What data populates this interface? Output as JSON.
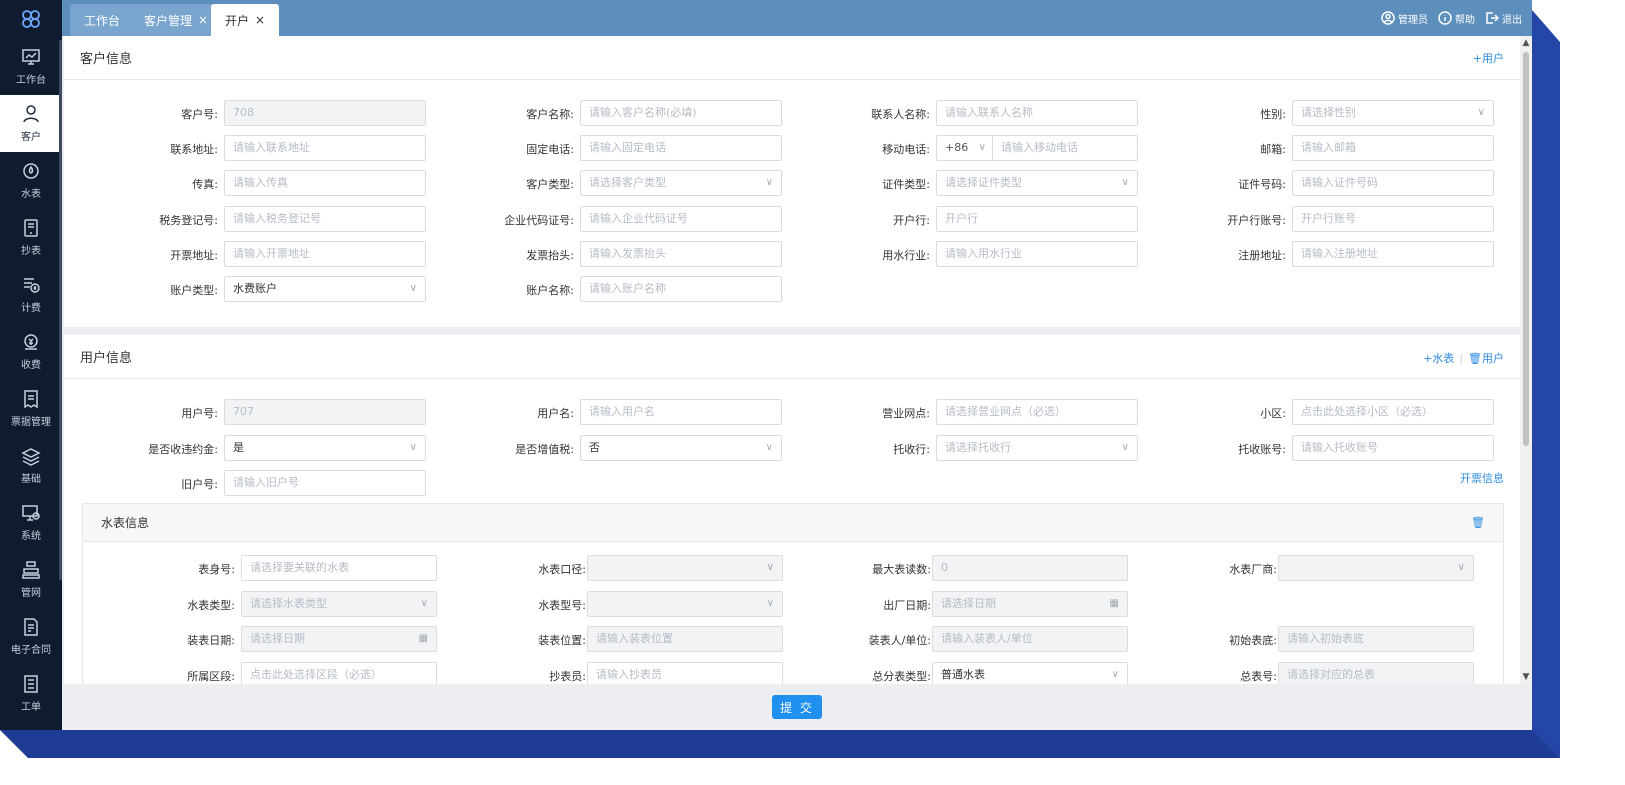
{
  "tabs": [
    {
      "label": "工作台",
      "closable": false
    },
    {
      "label": "客户管理",
      "closable": true
    },
    {
      "label": "开户",
      "closable": true,
      "active": true
    }
  ],
  "header": {
    "admin": "管理员",
    "help": "帮助",
    "logout": "退出"
  },
  "sidebar": [
    {
      "label": "工作台",
      "icon": "monitor-chart-icon"
    },
    {
      "label": "客户",
      "icon": "user-icon",
      "active": true
    },
    {
      "label": "水表",
      "icon": "water-meter-icon"
    },
    {
      "label": "抄表",
      "icon": "tablet-icon"
    },
    {
      "label": "计费",
      "icon": "billing-icon"
    },
    {
      "label": "收费",
      "icon": "coin-icon"
    },
    {
      "label": "票据管理",
      "icon": "receipt-icon"
    },
    {
      "label": "基础",
      "icon": "layers-icon"
    },
    {
      "label": "系统",
      "icon": "system-settings-icon"
    },
    {
      "label": "管网",
      "icon": "pipe-network-icon"
    },
    {
      "label": "电子合同",
      "icon": "contract-icon"
    },
    {
      "label": "工单",
      "icon": "work-order-icon"
    }
  ],
  "customer": {
    "title": "客户信息",
    "add_user": "+用户",
    "rows": [
      [
        {
          "label": "客户号:",
          "text": "708",
          "style": "dis"
        },
        {
          "label": "客户名称:",
          "text": "请输入客户名称(必填)"
        },
        {
          "label": "联系人名称:",
          "text": "请输入联系人名称"
        },
        {
          "label": "性别:",
          "text": "请选择性别",
          "select": true
        }
      ],
      [
        {
          "label": "联系地址:",
          "text": "请输入联系地址"
        },
        {
          "label": "固定电话:",
          "text": "请输入固定电话"
        },
        {
          "label": "移动电话:",
          "text": "请输入移动电话",
          "prefix": "+86"
        },
        {
          "label": "邮箱:",
          "text": "请输入邮箱"
        }
      ],
      [
        {
          "label": "传真:",
          "text": "请输入传真"
        },
        {
          "label": "客户类型:",
          "text": "请选择客户类型",
          "select": true
        },
        {
          "label": "证件类型:",
          "text": "请选择证件类型",
          "select": true
        },
        {
          "label": "证件号码:",
          "text": "请输入证件号码"
        }
      ],
      [
        {
          "label": "税务登记号:",
          "text": "请输入税务登记号"
        },
        {
          "label": "企业代码证号:",
          "text": "请输入企业代码证号"
        },
        {
          "label": "开户行:",
          "text": "开户行"
        },
        {
          "label": "开户行账号:",
          "text": "开户行账号"
        }
      ],
      [
        {
          "label": "开票地址:",
          "text": "请输入开票地址"
        },
        {
          "label": "发票抬头:",
          "text": "请输入发票抬头"
        },
        {
          "label": "用水行业:",
          "text": "请输入用水行业"
        },
        {
          "label": "注册地址:",
          "text": "请输入注册地址"
        }
      ],
      [
        {
          "label": "账户类型:",
          "text": "水费账户",
          "select": true,
          "style": "val"
        },
        {
          "label": "账户名称:",
          "text": "请输入账户名称"
        }
      ]
    ]
  },
  "user": {
    "title": "用户信息",
    "add_meter": "+水表",
    "delete_user": "用户",
    "invoice_link": "开票信息",
    "rows": [
      [
        {
          "label": "用户号:",
          "text": "707",
          "style": "dis"
        },
        {
          "label": "用户名:",
          "text": "请输入用户名"
        },
        {
          "label": "营业网点:",
          "text": "请选择营业网点（必选）"
        },
        {
          "label": "小区:",
          "text": "点击此处选择小区（必选）"
        }
      ],
      [
        {
          "label": "是否收违约金:",
          "text": "是",
          "select": true,
          "style": "val"
        },
        {
          "label": "是否增值税:",
          "text": "否",
          "select": true,
          "style": "val"
        },
        {
          "label": "托收行:",
          "text": "请选择托收行",
          "select": true
        },
        {
          "label": "托收账号:",
          "text": "请输入托收账号"
        }
      ],
      [
        {
          "label": "旧户号:",
          "text": "请输入旧户号"
        }
      ]
    ]
  },
  "meter": {
    "title": "水表信息",
    "rows": [
      [
        {
          "label": "表身号:",
          "text": "请选择要关联的水表"
        },
        {
          "label": "水表口径:",
          "text": "",
          "select": true,
          "style": "dis"
        },
        {
          "label": "最大表读数:",
          "text": "0",
          "style": "dis"
        },
        {
          "label": "水表厂商:",
          "text": "",
          "select": true,
          "style": "dis"
        }
      ],
      [
        {
          "label": "水表类型:",
          "text": "请选择水表类型",
          "select": true,
          "style": "dis"
        },
        {
          "label": "水表型号:",
          "text": "",
          "select": true,
          "style": "dis"
        },
        {
          "label": "出厂日期:",
          "text": "请选择日期",
          "date": true,
          "style": "dis"
        }
      ],
      [
        {
          "label": "装表日期:",
          "text": "请选择日期",
          "date": true,
          "style": "dis"
        },
        {
          "label": "装表位置:",
          "text": "请输入装表位置",
          "style": "dis"
        },
        {
          "label": "装表人/单位:",
          "text": "请输入装表人/单位",
          "style": "dis"
        },
        {
          "label": "初始表底:",
          "text": "请输入初始表底",
          "style": "dis"
        }
      ],
      [
        {
          "label": "所属区段:",
          "text": "点击此处选择区段（必选）"
        },
        {
          "label": "抄表员:",
          "text": "请输入抄表员"
        },
        {
          "label": "总分表类型:",
          "text": "普通水表",
          "select": true,
          "style": "val"
        },
        {
          "label": "总表号:",
          "text": "请选择对应的总表",
          "style": "dis"
        }
      ]
    ]
  },
  "footer": {
    "submit": "提 交"
  }
}
